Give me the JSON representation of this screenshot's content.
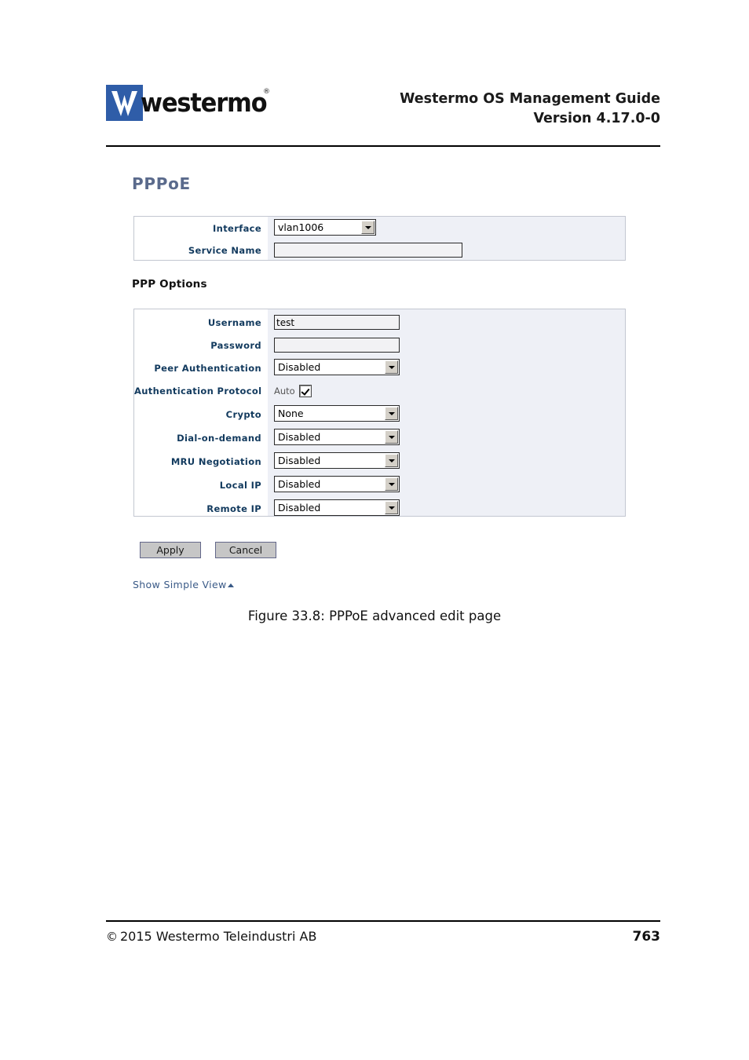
{
  "header": {
    "logo_text": "westermo",
    "logo_registered": "®",
    "logo_icon": "westermo-w-logo",
    "title_line1": "Westermo OS Management Guide",
    "title_line2": "Version 4.17.0-0"
  },
  "content": {
    "page_heading": "PPPoE",
    "section_heading": "PPP Options",
    "interface_panel": {
      "rows": [
        {
          "label": "Interface",
          "control": "select",
          "value": "vlan1006"
        },
        {
          "label": "Service Name",
          "control": "text",
          "value": "",
          "placeholder": ""
        }
      ]
    },
    "ppp_options_panel": {
      "rows": [
        {
          "label": "Username",
          "control": "text",
          "value": "test",
          "placeholder": ""
        },
        {
          "label": "Password",
          "control": "text",
          "value": "",
          "placeholder": ""
        },
        {
          "label": "Peer Authentication",
          "control": "select",
          "value": "Disabled"
        },
        {
          "label": "Authentication Protocol",
          "control": "checkbox",
          "value": "Auto",
          "checked": true
        },
        {
          "label": "Crypto",
          "control": "select",
          "value": "None"
        },
        {
          "label": "Dial-on-demand",
          "control": "select",
          "value": "Disabled"
        },
        {
          "label": "MRU Negotiation",
          "control": "select",
          "value": "Disabled"
        },
        {
          "label": "Local IP",
          "control": "select",
          "value": "Disabled"
        },
        {
          "label": "Remote IP",
          "control": "select",
          "value": "Disabled"
        }
      ]
    },
    "buttons": {
      "apply": "Apply",
      "cancel": "Cancel"
    },
    "simple_view_link": "Show Simple View",
    "simple_view_caret": "caret-up-icon",
    "figure_caption": "Figure 33.8: PPPoE advanced edit page"
  },
  "footer": {
    "copyright_symbol": "©",
    "copyright": "2015 Westermo Teleindustri AB",
    "page_number": "763"
  },
  "colors": {
    "heading_blue": "#5a6a8c",
    "label_navy": "#123a5e",
    "panel_bg": "#eef0f6",
    "panel_border": "#c3c7d1",
    "logo_blue": "#2f5da8",
    "link_blue": "#3a5a87",
    "button_face": "#c6c6c6"
  }
}
